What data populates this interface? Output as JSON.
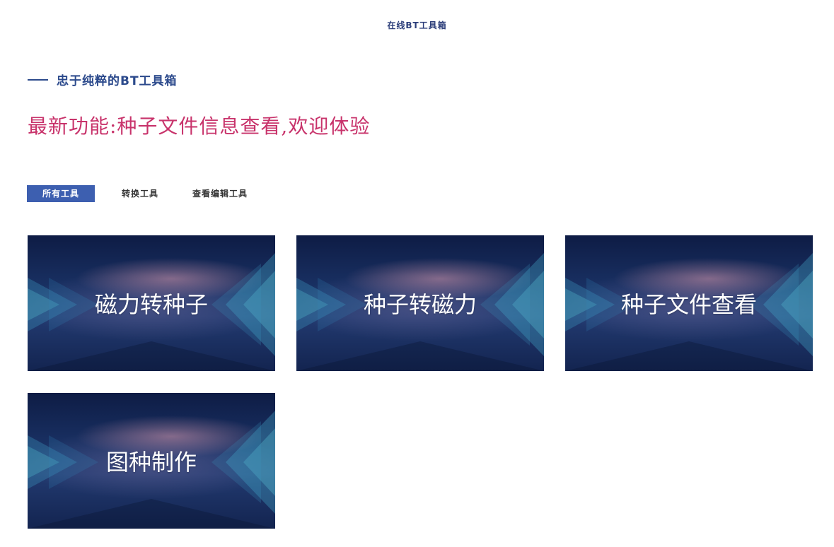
{
  "header": {
    "site_title": "在线BT工具箱"
  },
  "hero": {
    "tagline": "忠于纯粹的BT工具箱",
    "headline": "最新功能:种子文件信息查看,欢迎体验"
  },
  "filters": [
    {
      "label": "所有工具",
      "active": true
    },
    {
      "label": "转换工具",
      "active": false
    },
    {
      "label": "查看编辑工具",
      "active": false
    }
  ],
  "tools": [
    {
      "label": "磁力转种子"
    },
    {
      "label": "种子转磁力"
    },
    {
      "label": "种子文件查看"
    },
    {
      "label": "图种制作"
    }
  ],
  "colors": {
    "accent": "#3d5fb0",
    "headline": "#c8336b",
    "tagline": "#2c4a8c"
  }
}
